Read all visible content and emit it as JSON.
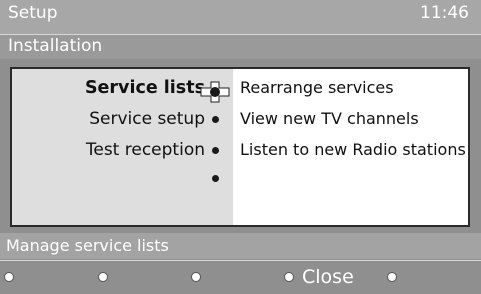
{
  "header": {
    "title": "Setup",
    "time": "11:46"
  },
  "breadcrumb": {
    "section": "Installation"
  },
  "menu": {
    "items": [
      {
        "label": "Service lists",
        "selected": true
      },
      {
        "label": "Service setup",
        "selected": false
      },
      {
        "label": "Test reception",
        "selected": false
      }
    ]
  },
  "options": {
    "items": [
      {
        "label": "Rearrange services"
      },
      {
        "label": "View new TV channels"
      },
      {
        "label": "Listen to new Radio stations"
      }
    ]
  },
  "hint": {
    "text": "Manage service lists"
  },
  "footer": {
    "close_label": "Close"
  },
  "icons": {
    "cursor": "navigation-cross-icon",
    "bullet": "bullet-dot-icon",
    "color_key": "remote-color-key-icon"
  },
  "colors": {
    "panel_left": "#dedede",
    "panel_right": "#ffffff",
    "bar": "#a7a7a7"
  }
}
